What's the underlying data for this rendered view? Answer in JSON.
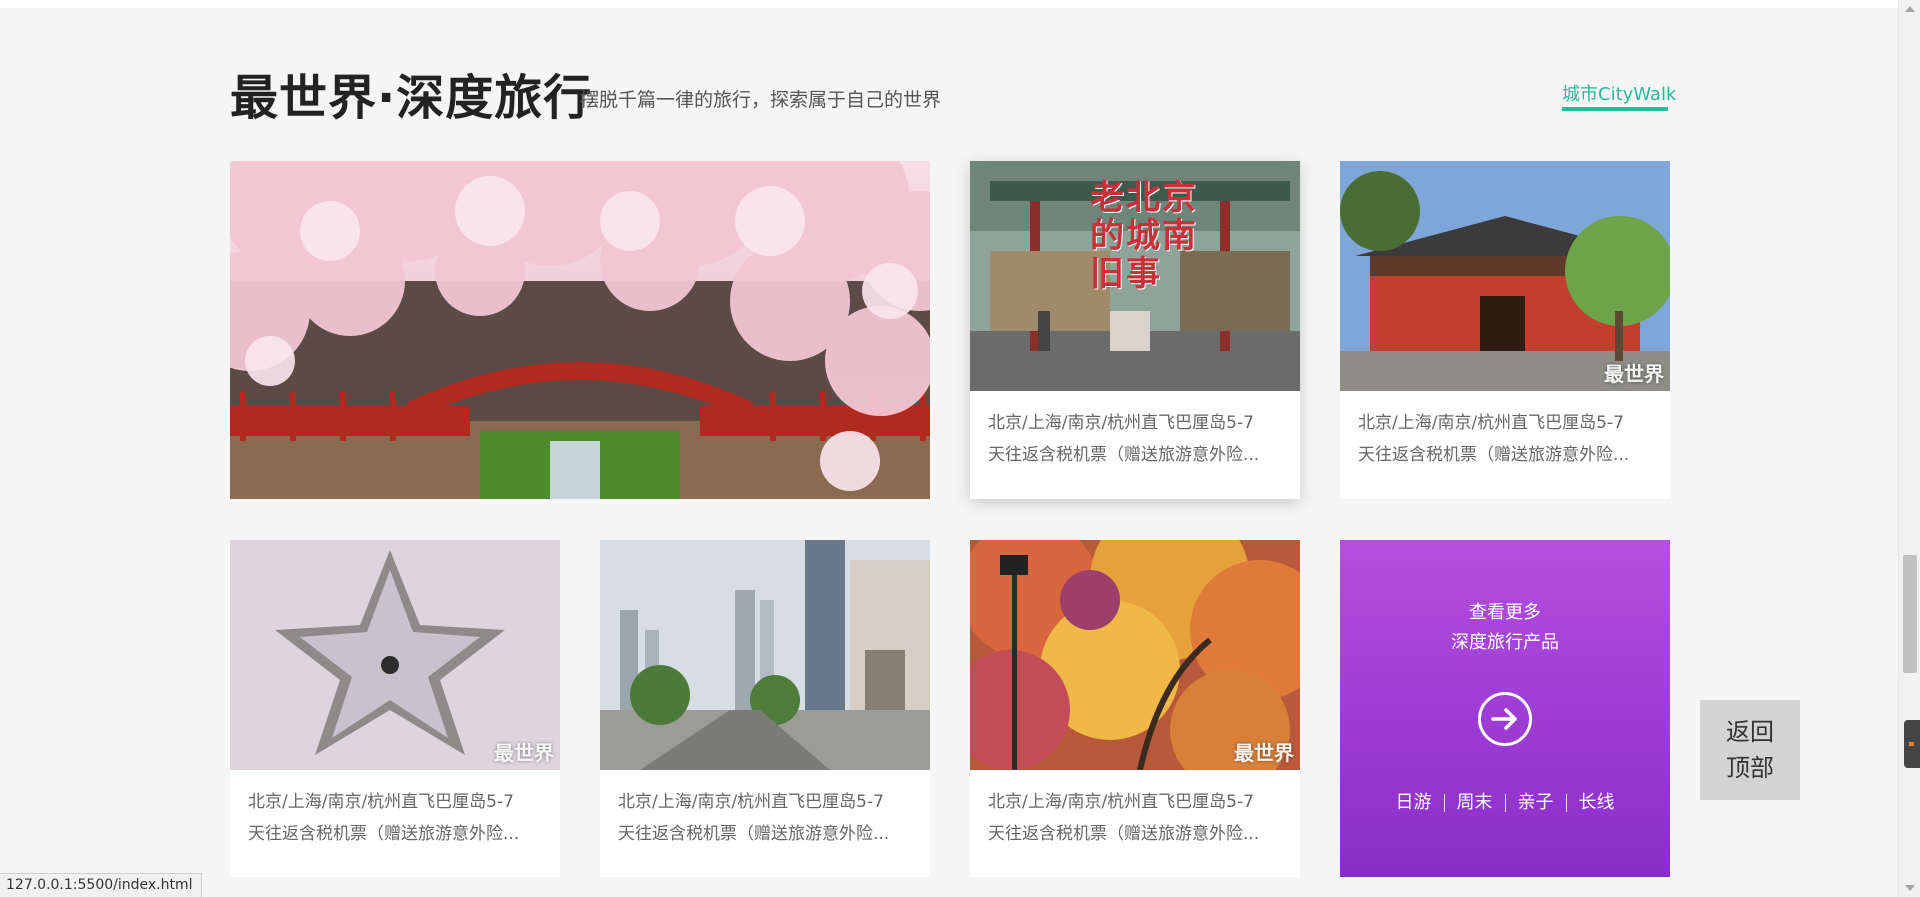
{
  "header": {
    "title": "最世界·深度旅行",
    "subtitle": "摆脱千篇一律的旅行，探索属于自己的世界",
    "tab": "城市CityWalk",
    "accent_color": "#2bb99b"
  },
  "cards": [
    {
      "name": "cherry-blossom-bridge",
      "photo": "cherry-blossom-bridge-photo"
    },
    {
      "name": "old-beijing-gate",
      "photo": "old-beijing-gate-photo",
      "photo_text": "老北京的城南旧事",
      "watermark": "",
      "line1": "北京/上海/南京/杭州直飞巴厘岛5-7",
      "line2": "天往返含税机票（赠送旅游意外险..."
    },
    {
      "name": "red-temple",
      "photo": "red-temple-photo",
      "watermark": "最世界",
      "line1": "北京/上海/南京/杭州直飞巴厘岛5-7",
      "line2": "天往返含税机票（赠送旅游意外险..."
    },
    {
      "name": "star-ceiling",
      "photo": "star-ceiling-photo",
      "watermark": "最世界",
      "line1": "北京/上海/南京/杭州直飞巴厘岛5-7",
      "line2": "天往返含税机票（赠送旅游意外险..."
    },
    {
      "name": "city-street",
      "photo": "city-street-photo",
      "watermark": "",
      "line1": "北京/上海/南京/杭州直飞巴厘岛5-7",
      "line2": "天往返含税机票（赠送旅游意外险..."
    },
    {
      "name": "autumn-trees",
      "photo": "autumn-trees-photo",
      "watermark": "最世界",
      "line1": "北京/上海/南京/杭州直飞巴厘岛5-7",
      "line2": "天往返含税机票（赠送旅游意外险..."
    }
  ],
  "more": {
    "line1": "查看更多",
    "line2": "深度旅行产品",
    "icon": "arrow-right-circle-icon",
    "links": [
      "日游",
      "周末",
      "亲子",
      "长线"
    ],
    "color": "#a43ed6"
  },
  "back_top": {
    "line1": "返回",
    "line2": "顶部"
  },
  "status_bar": {
    "url": "127.0.0.1:5500/index.html"
  }
}
